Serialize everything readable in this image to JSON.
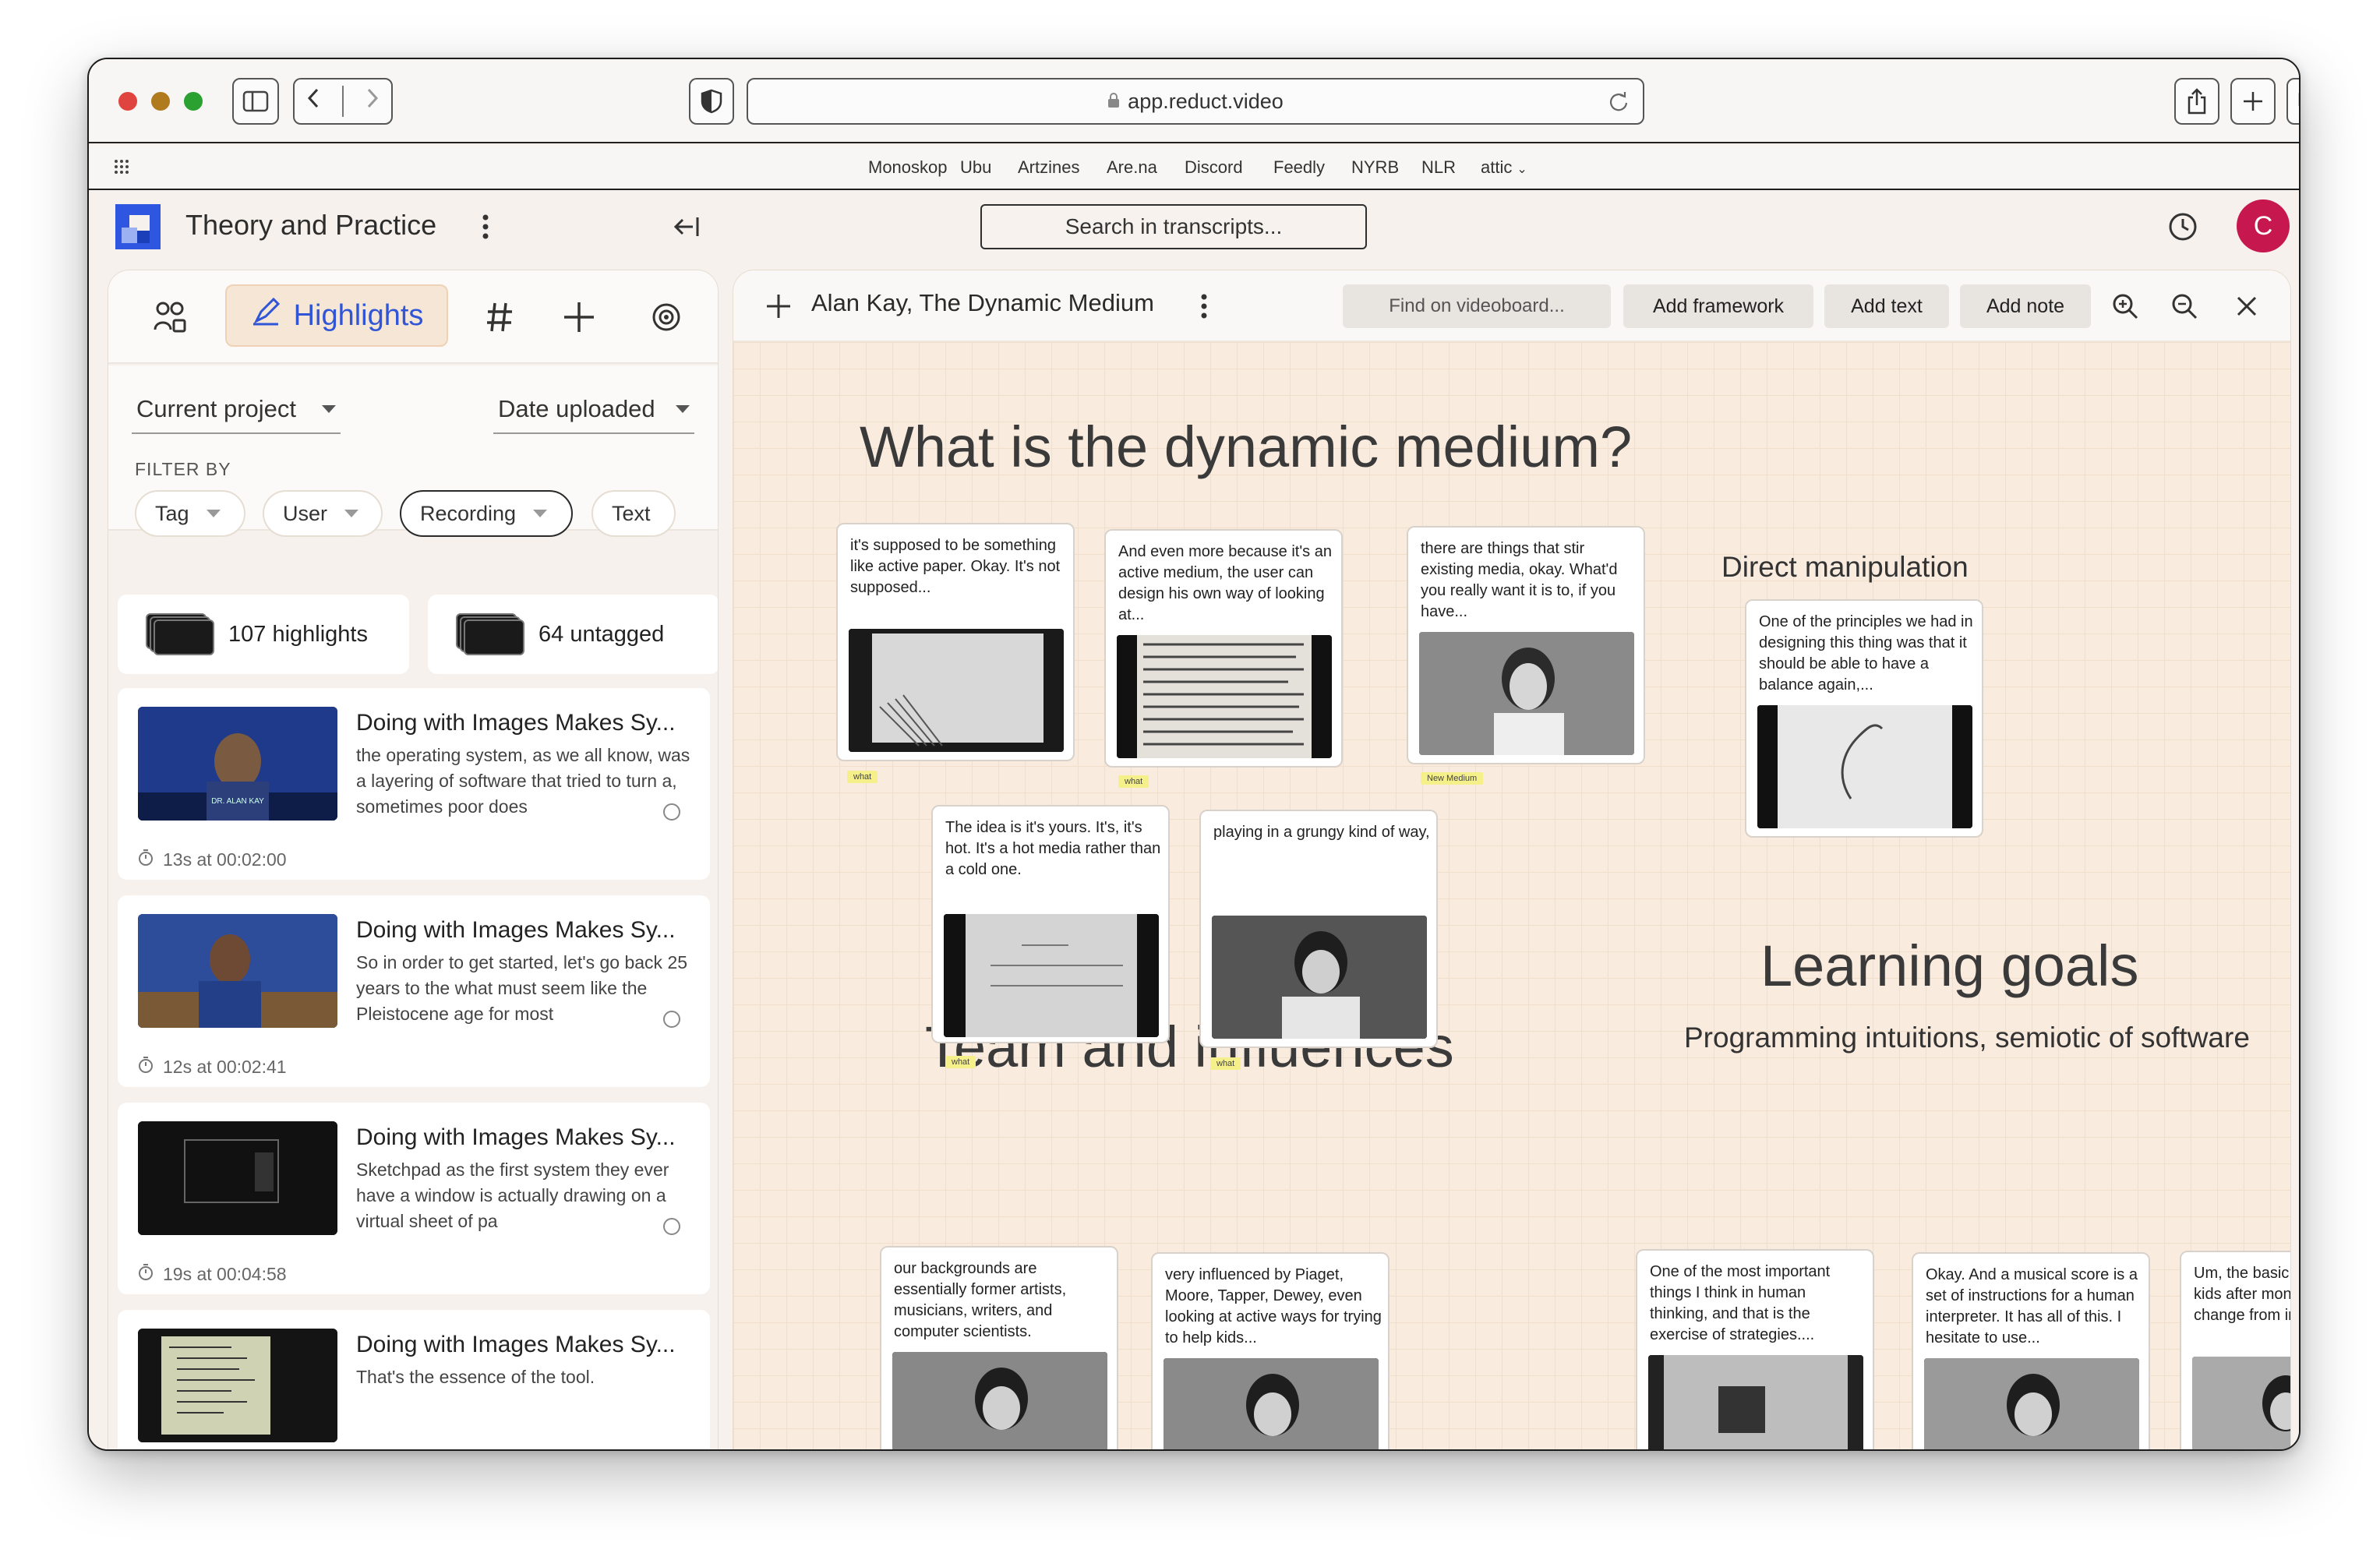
{
  "browser": {
    "url": "app.reduct.video",
    "bookmarks": [
      "Monoskop",
      "Ubu",
      "Artzines",
      "Are.na",
      "Discord",
      "Feedly",
      "NYRB",
      "NLR",
      "attic"
    ]
  },
  "app": {
    "project_title": "Theory and Practice",
    "search_placeholder": "Search in transcripts...",
    "avatar_letter": "C",
    "accent_color": "#3055d6",
    "avatar_color": "#c7174f"
  },
  "sidebar": {
    "active_tab": "Highlights",
    "scope_dropdown": "Current project",
    "sort_dropdown": "Date uploaded",
    "filter_label": "FILTER BY",
    "filter_chips": [
      "Tag",
      "User",
      "Recording",
      "Text"
    ],
    "stats": {
      "highlights": "107 highlights",
      "untagged": "64 untagged"
    },
    "cards": [
      {
        "title": "Doing with Images Makes Sy...",
        "text": "the operating system, as we all know, was a layering of software that tried to turn a, sometimes poor does",
        "meta": "13s at 00:02:00"
      },
      {
        "title": "Doing with Images Makes Sy...",
        "text": "So in order to get started, let's go back 25 years to the what must seem like the Pleistocene age for most",
        "meta": "12s at 00:02:41"
      },
      {
        "title": "Doing with Images Makes Sy...",
        "text": "Sketchpad as the first system they ever have a window is actually drawing on a virtual sheet of pa",
        "meta": "19s at 00:04:58"
      },
      {
        "title": "Doing with Images Makes Sy...",
        "text": "That's the essence of the tool.",
        "meta": ""
      }
    ]
  },
  "board": {
    "title": "Alan Kay, The Dynamic Medium",
    "find_placeholder": "Find on videoboard...",
    "buttons": [
      "Add framework",
      "Add text",
      "Add note"
    ],
    "headings": {
      "main": "What is the dynamic medium?",
      "direct": "Direct manipulation",
      "learning": "Learning goals",
      "learning_sub": "Programming intuitions, semiotic of software",
      "team": "Team and influences"
    },
    "clips": [
      {
        "text": "it's supposed to be something like active paper. Okay. It's not supposed...",
        "tag": "what"
      },
      {
        "text": "And even more because it's an active medium, the user can design his own way of looking at...",
        "tag": "what"
      },
      {
        "text": "there are things that stir existing media, okay. What'd you really want it is to, if you have...",
        "tag": "New Medium"
      },
      {
        "text": "One of the principles we had in designing this thing was that it should be able to have a balance again,...",
        "tag": ""
      },
      {
        "text": "The idea is it's yours. It's, it's hot. It's a hot media rather than a cold one.",
        "tag": "what"
      },
      {
        "text": "playing in a grungy kind of way,",
        "tag": "what"
      },
      {
        "text": "our backgrounds are essentially former artists, musicians, writers, and computer scientists.",
        "tag": ""
      },
      {
        "text": "very influenced by Piaget, Moore, Tapper, Dewey, even looking at active ways for trying to help kids...",
        "tag": ""
      },
      {
        "text": "One of the most important things I think in human thinking, and that is the exercise of strategies....",
        "tag": ""
      },
      {
        "text": "Okay. And a musical score is a set of instructions for a human interpreter. It has all of this. I hesitate to use...",
        "tag": ""
      },
      {
        "text": "Um, the basic c in the kids after months doing t change from in",
        "tag": ""
      }
    ],
    "help": "?"
  }
}
